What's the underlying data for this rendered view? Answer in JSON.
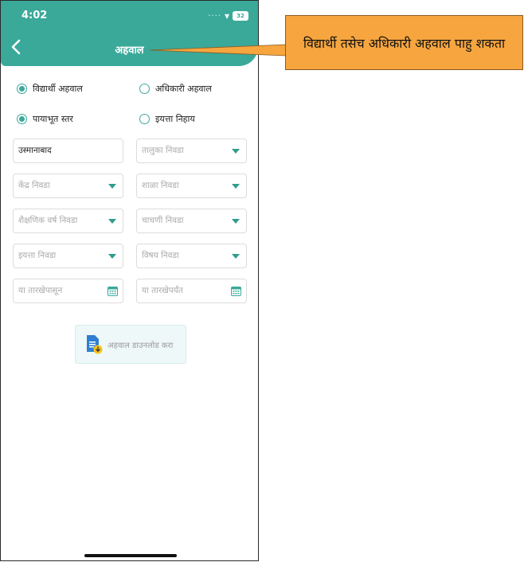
{
  "status_bar": {
    "time": "4:02",
    "battery": "32"
  },
  "header": {
    "title": "अहवाल",
    "back_icon": "chevron-left-icon"
  },
  "radio_groups": {
    "report_type": [
      {
        "label": "विद्यार्थी अहवाल",
        "checked": true
      },
      {
        "label": "अधिकारी अहवाल",
        "checked": false
      }
    ],
    "level": [
      {
        "label": "पायाभूत स्तर",
        "checked": true
      },
      {
        "label": "इयत्ता निहाय",
        "checked": false
      }
    ]
  },
  "fields": {
    "district": "उस्मानाबाद",
    "taluka": "तालुका निवडा",
    "center": "केंद्र निवडा",
    "school": "शाळा निवडा",
    "academic_year": "शैक्षणिक वर्ष निवडा",
    "test": "चाचणी निवडा",
    "grade": "इयत्ता निवडा",
    "subject": "विषय निवडा",
    "from_date": "या तारखेपासून",
    "to_date": "या तारखेपर्यंत"
  },
  "download": {
    "label": "अहवाल डाउनलोड करा",
    "icon": "document-download-icon"
  },
  "callout": {
    "text": "विद्यार्थी तसेच अधिकारी अहवाल पाहु शकता"
  },
  "colors": {
    "accent": "#3aa99a",
    "callout_bg": "#f6a53f"
  }
}
